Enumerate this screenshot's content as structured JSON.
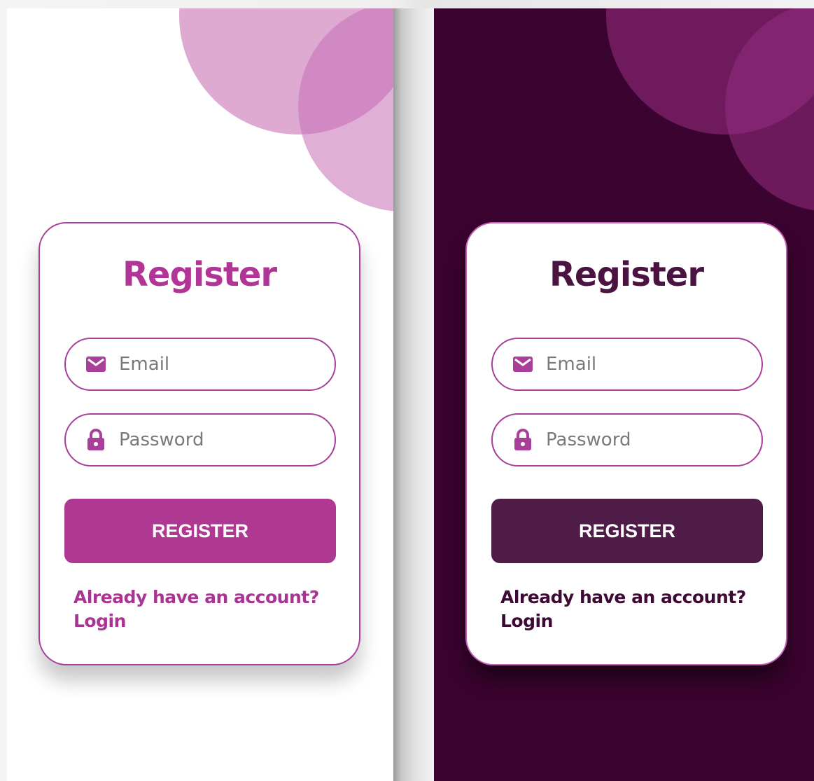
{
  "light": {
    "title": "Register",
    "email_placeholder": "Email",
    "password_placeholder": "Password",
    "button_label": "REGISTER",
    "account_prompt": "Already have an account?",
    "login_link": "Login"
  },
  "dark": {
    "title": "Register",
    "email_placeholder": "Email",
    "password_placeholder": "Password",
    "button_label": "REGISTER",
    "account_prompt": "Already have an account?",
    "login_link": "Login"
  },
  "icons": [
    "mail-icon",
    "lock-icon"
  ],
  "colors": {
    "light_accent": "#af3892",
    "dark_background": "#3b0330",
    "dark_button": "#4e1c47",
    "field_border": "#a8409a"
  }
}
